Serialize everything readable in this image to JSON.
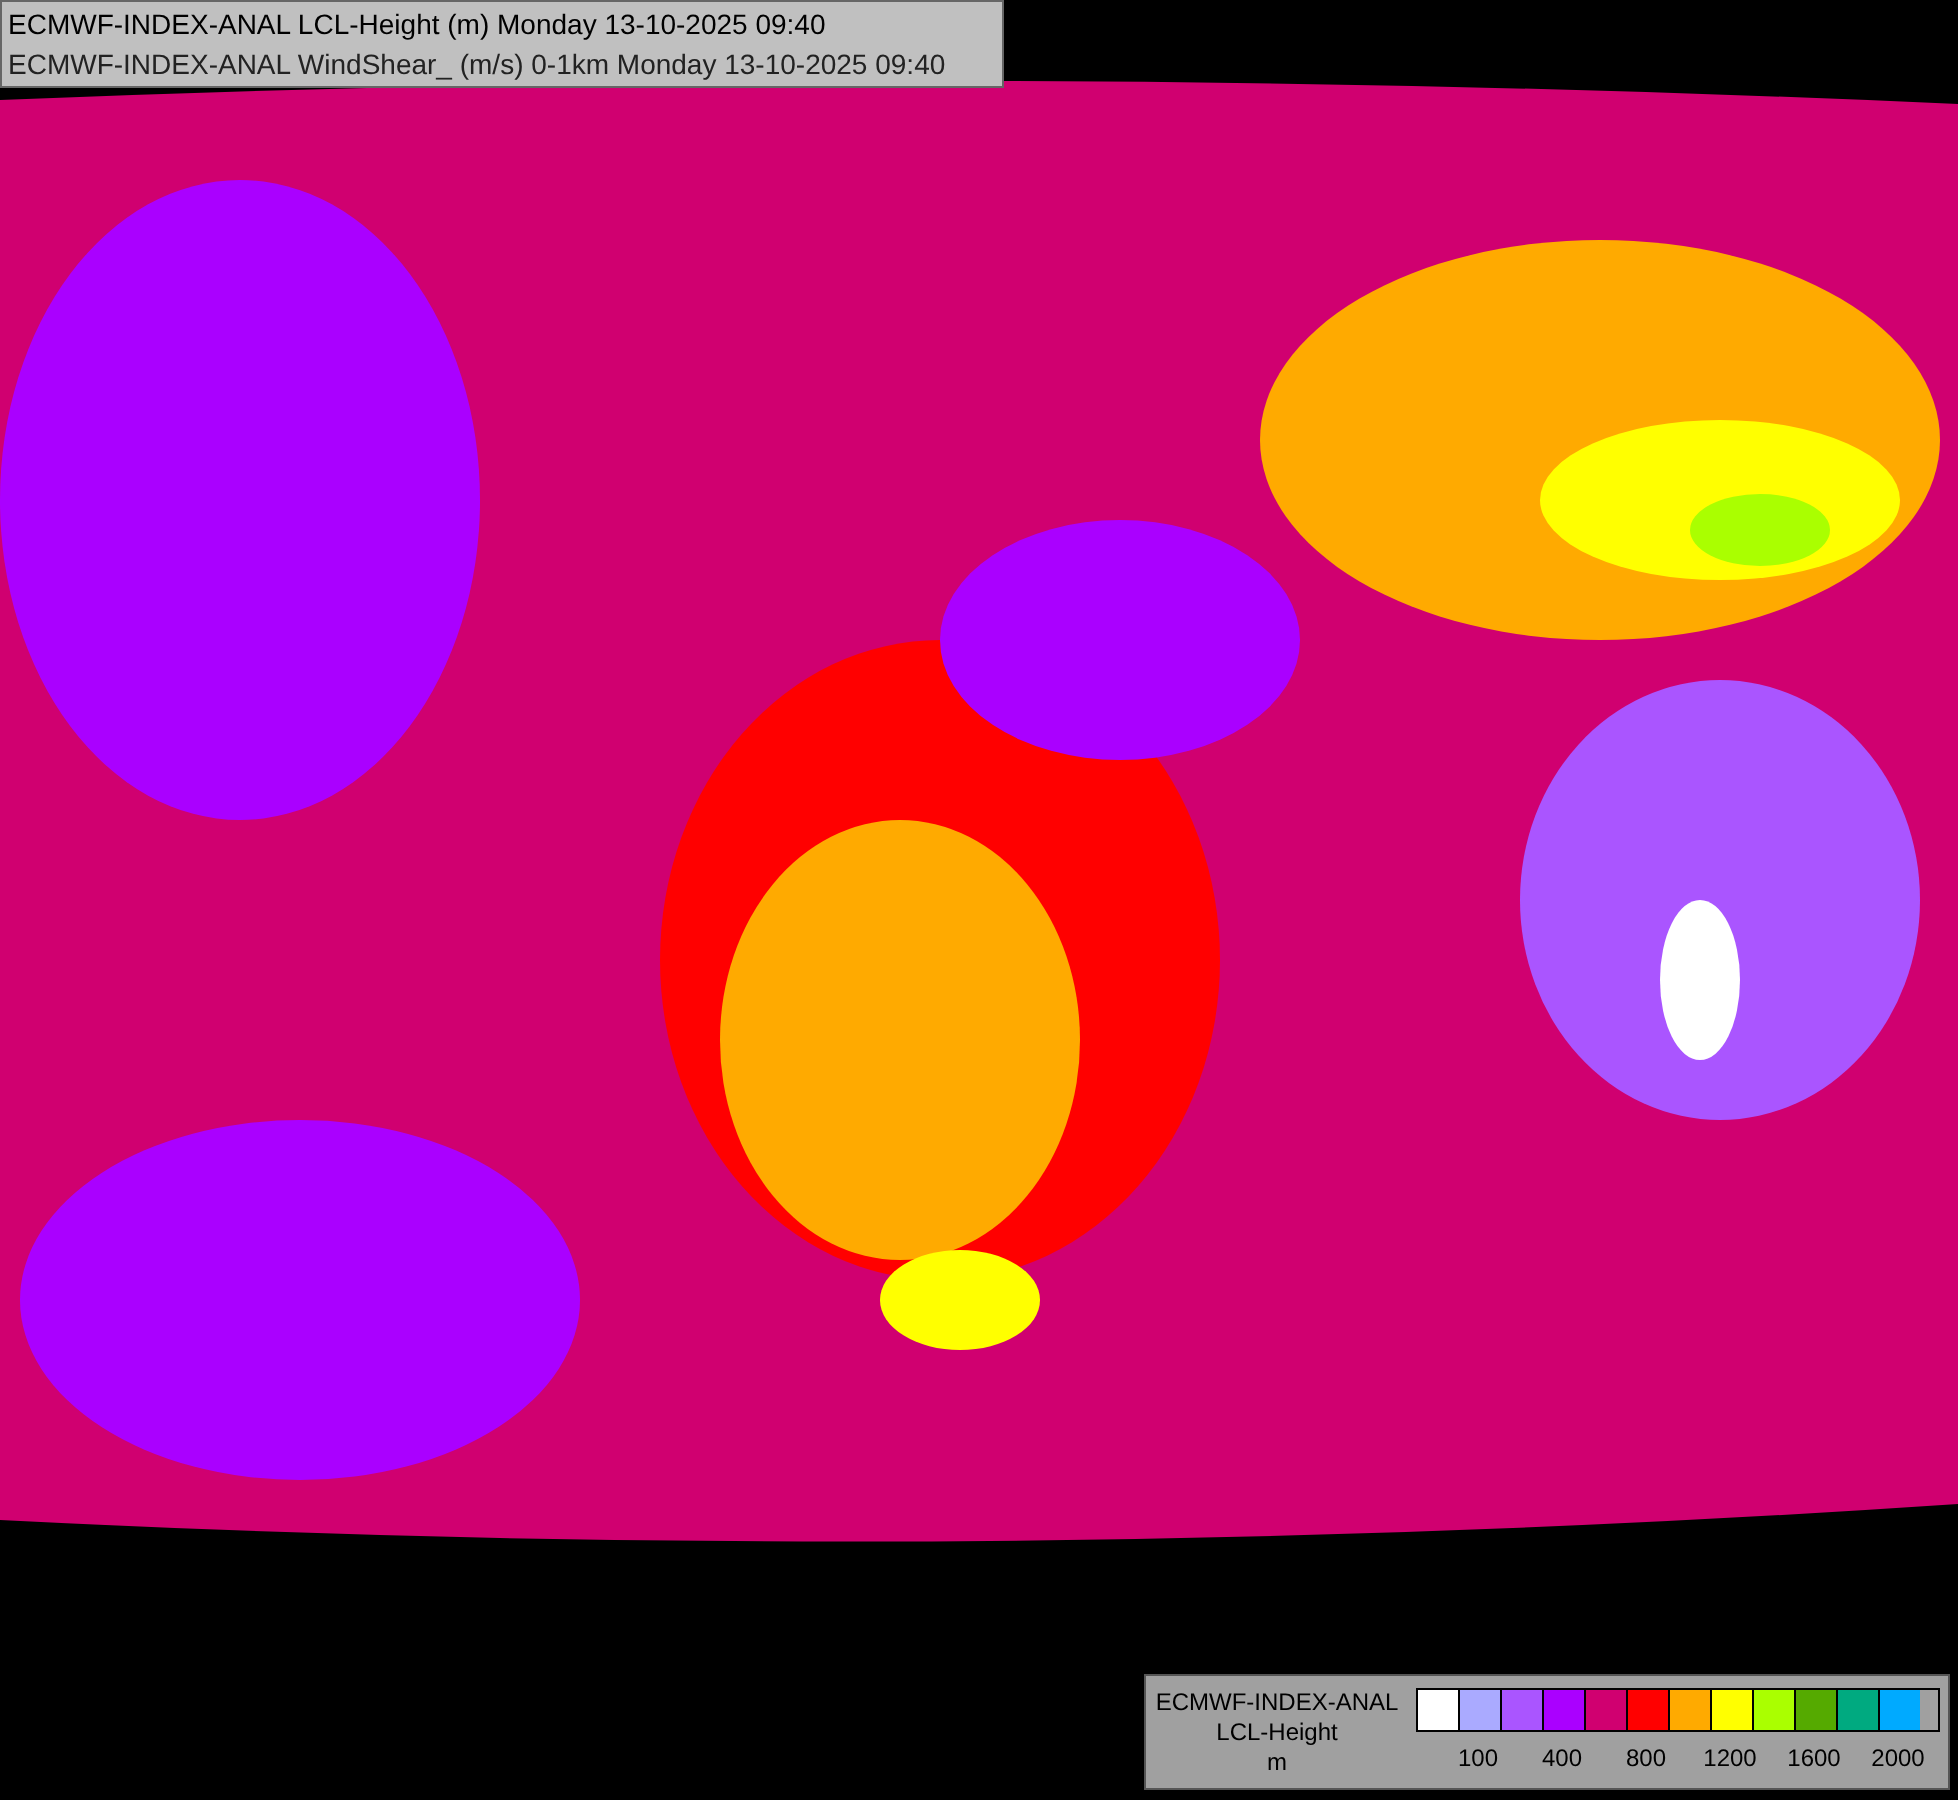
{
  "titles": [
    "ECMWF-INDEX-ANAL LCL-Height (m) Monday 13-10-2025 09:40",
    "ECMWF-INDEX-ANAL WindShear_ (m/s) 0-1km Monday 13-10-2025 09:40"
  ],
  "legend": {
    "title_lines": [
      "ECMWF-INDEX-ANAL",
      "LCL-Height",
      "m"
    ],
    "swatches": [
      {
        "color": "#ffffff"
      },
      {
        "color": "#aaaaff"
      },
      {
        "color": "#aa55ff"
      },
      {
        "color": "#aa00ff"
      },
      {
        "color": "#d00070"
      },
      {
        "color": "#ff0000"
      },
      {
        "color": "#ffaa00"
      },
      {
        "color": "#ffff00"
      },
      {
        "color": "#aaff00"
      },
      {
        "color": "#55aa00"
      },
      {
        "color": "#00aa80"
      },
      {
        "color": "#00aaff"
      }
    ],
    "tick_labels": [
      "100",
      "400",
      "800",
      "1200",
      "1600",
      "2000"
    ]
  }
}
